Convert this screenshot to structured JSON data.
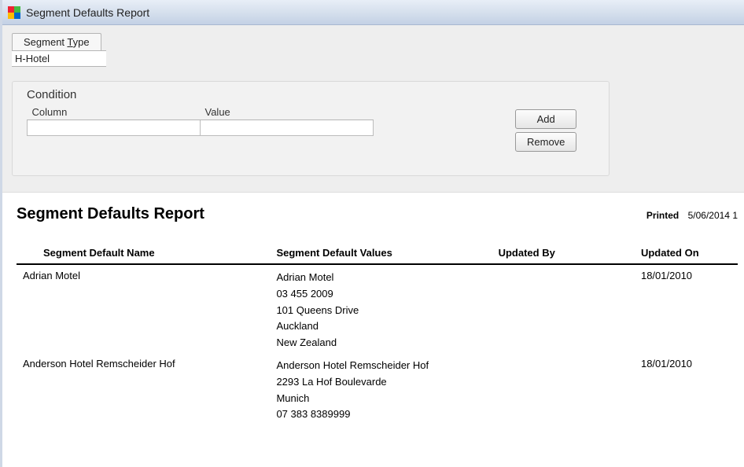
{
  "window": {
    "title": "Segment Defaults Report"
  },
  "filter": {
    "segment_type_label_pre": "Segment ",
    "segment_type_label_accel": "T",
    "segment_type_label_post": "ype",
    "segment_type_value": "H-Hotel"
  },
  "condition": {
    "title": "Condition",
    "col_column": "Column",
    "col_value": "Value",
    "row": {
      "column": "",
      "value": ""
    },
    "add_label": "Add",
    "remove_label": "Remove"
  },
  "report": {
    "title": "Segment Defaults Report",
    "printed_label": "Printed",
    "printed_value": "5/06/2014 1",
    "columns": {
      "name": "Segment Default Name",
      "values": "Segment Default Values",
      "updated_by": "Updated By",
      "updated_on": "Updated On"
    },
    "rows": [
      {
        "name": "Adrian Motel",
        "values": [
          "Adrian Motel",
          "03 455 2009",
          "101 Queens Drive",
          "Auckland",
          "New Zealand"
        ],
        "updated_by": "",
        "updated_on": "18/01/2010"
      },
      {
        "name": "Anderson Hotel Remscheider Hof",
        "values": [
          "Anderson Hotel Remscheider Hof",
          "2293 La Hof Boulevarde",
          "Munich",
          "07 383 8389999"
        ],
        "updated_by": "",
        "updated_on": "18/01/2010"
      }
    ]
  }
}
